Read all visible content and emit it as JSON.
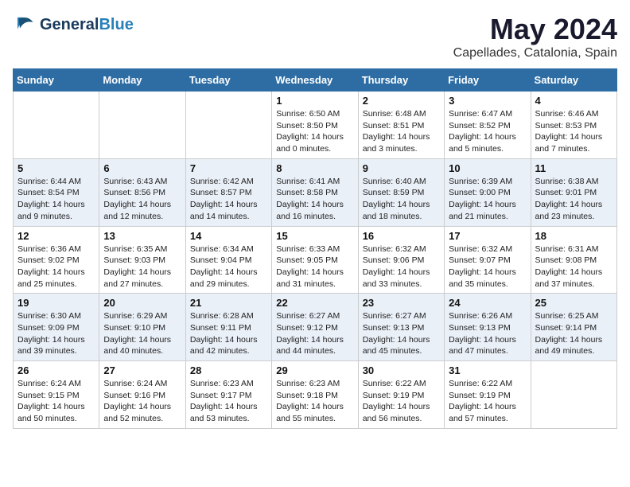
{
  "header": {
    "logo_line1": "General",
    "logo_line2": "Blue",
    "main_title": "May 2024",
    "sub_title": "Capellades, Catalonia, Spain"
  },
  "weekdays": [
    "Sunday",
    "Monday",
    "Tuesday",
    "Wednesday",
    "Thursday",
    "Friday",
    "Saturday"
  ],
  "weeks": [
    [
      {
        "day": "",
        "info": ""
      },
      {
        "day": "",
        "info": ""
      },
      {
        "day": "",
        "info": ""
      },
      {
        "day": "1",
        "info": "Sunrise: 6:50 AM\nSunset: 8:50 PM\nDaylight: 14 hours\nand 0 minutes."
      },
      {
        "day": "2",
        "info": "Sunrise: 6:48 AM\nSunset: 8:51 PM\nDaylight: 14 hours\nand 3 minutes."
      },
      {
        "day": "3",
        "info": "Sunrise: 6:47 AM\nSunset: 8:52 PM\nDaylight: 14 hours\nand 5 minutes."
      },
      {
        "day": "4",
        "info": "Sunrise: 6:46 AM\nSunset: 8:53 PM\nDaylight: 14 hours\nand 7 minutes."
      }
    ],
    [
      {
        "day": "5",
        "info": "Sunrise: 6:44 AM\nSunset: 8:54 PM\nDaylight: 14 hours\nand 9 minutes."
      },
      {
        "day": "6",
        "info": "Sunrise: 6:43 AM\nSunset: 8:56 PM\nDaylight: 14 hours\nand 12 minutes."
      },
      {
        "day": "7",
        "info": "Sunrise: 6:42 AM\nSunset: 8:57 PM\nDaylight: 14 hours\nand 14 minutes."
      },
      {
        "day": "8",
        "info": "Sunrise: 6:41 AM\nSunset: 8:58 PM\nDaylight: 14 hours\nand 16 minutes."
      },
      {
        "day": "9",
        "info": "Sunrise: 6:40 AM\nSunset: 8:59 PM\nDaylight: 14 hours\nand 18 minutes."
      },
      {
        "day": "10",
        "info": "Sunrise: 6:39 AM\nSunset: 9:00 PM\nDaylight: 14 hours\nand 21 minutes."
      },
      {
        "day": "11",
        "info": "Sunrise: 6:38 AM\nSunset: 9:01 PM\nDaylight: 14 hours\nand 23 minutes."
      }
    ],
    [
      {
        "day": "12",
        "info": "Sunrise: 6:36 AM\nSunset: 9:02 PM\nDaylight: 14 hours\nand 25 minutes."
      },
      {
        "day": "13",
        "info": "Sunrise: 6:35 AM\nSunset: 9:03 PM\nDaylight: 14 hours\nand 27 minutes."
      },
      {
        "day": "14",
        "info": "Sunrise: 6:34 AM\nSunset: 9:04 PM\nDaylight: 14 hours\nand 29 minutes."
      },
      {
        "day": "15",
        "info": "Sunrise: 6:33 AM\nSunset: 9:05 PM\nDaylight: 14 hours\nand 31 minutes."
      },
      {
        "day": "16",
        "info": "Sunrise: 6:32 AM\nSunset: 9:06 PM\nDaylight: 14 hours\nand 33 minutes."
      },
      {
        "day": "17",
        "info": "Sunrise: 6:32 AM\nSunset: 9:07 PM\nDaylight: 14 hours\nand 35 minutes."
      },
      {
        "day": "18",
        "info": "Sunrise: 6:31 AM\nSunset: 9:08 PM\nDaylight: 14 hours\nand 37 minutes."
      }
    ],
    [
      {
        "day": "19",
        "info": "Sunrise: 6:30 AM\nSunset: 9:09 PM\nDaylight: 14 hours\nand 39 minutes."
      },
      {
        "day": "20",
        "info": "Sunrise: 6:29 AM\nSunset: 9:10 PM\nDaylight: 14 hours\nand 40 minutes."
      },
      {
        "day": "21",
        "info": "Sunrise: 6:28 AM\nSunset: 9:11 PM\nDaylight: 14 hours\nand 42 minutes."
      },
      {
        "day": "22",
        "info": "Sunrise: 6:27 AM\nSunset: 9:12 PM\nDaylight: 14 hours\nand 44 minutes."
      },
      {
        "day": "23",
        "info": "Sunrise: 6:27 AM\nSunset: 9:13 PM\nDaylight: 14 hours\nand 45 minutes."
      },
      {
        "day": "24",
        "info": "Sunrise: 6:26 AM\nSunset: 9:13 PM\nDaylight: 14 hours\nand 47 minutes."
      },
      {
        "day": "25",
        "info": "Sunrise: 6:25 AM\nSunset: 9:14 PM\nDaylight: 14 hours\nand 49 minutes."
      }
    ],
    [
      {
        "day": "26",
        "info": "Sunrise: 6:24 AM\nSunset: 9:15 PM\nDaylight: 14 hours\nand 50 minutes."
      },
      {
        "day": "27",
        "info": "Sunrise: 6:24 AM\nSunset: 9:16 PM\nDaylight: 14 hours\nand 52 minutes."
      },
      {
        "day": "28",
        "info": "Sunrise: 6:23 AM\nSunset: 9:17 PM\nDaylight: 14 hours\nand 53 minutes."
      },
      {
        "day": "29",
        "info": "Sunrise: 6:23 AM\nSunset: 9:18 PM\nDaylight: 14 hours\nand 55 minutes."
      },
      {
        "day": "30",
        "info": "Sunrise: 6:22 AM\nSunset: 9:19 PM\nDaylight: 14 hours\nand 56 minutes."
      },
      {
        "day": "31",
        "info": "Sunrise: 6:22 AM\nSunset: 9:19 PM\nDaylight: 14 hours\nand 57 minutes."
      },
      {
        "day": "",
        "info": ""
      }
    ]
  ]
}
